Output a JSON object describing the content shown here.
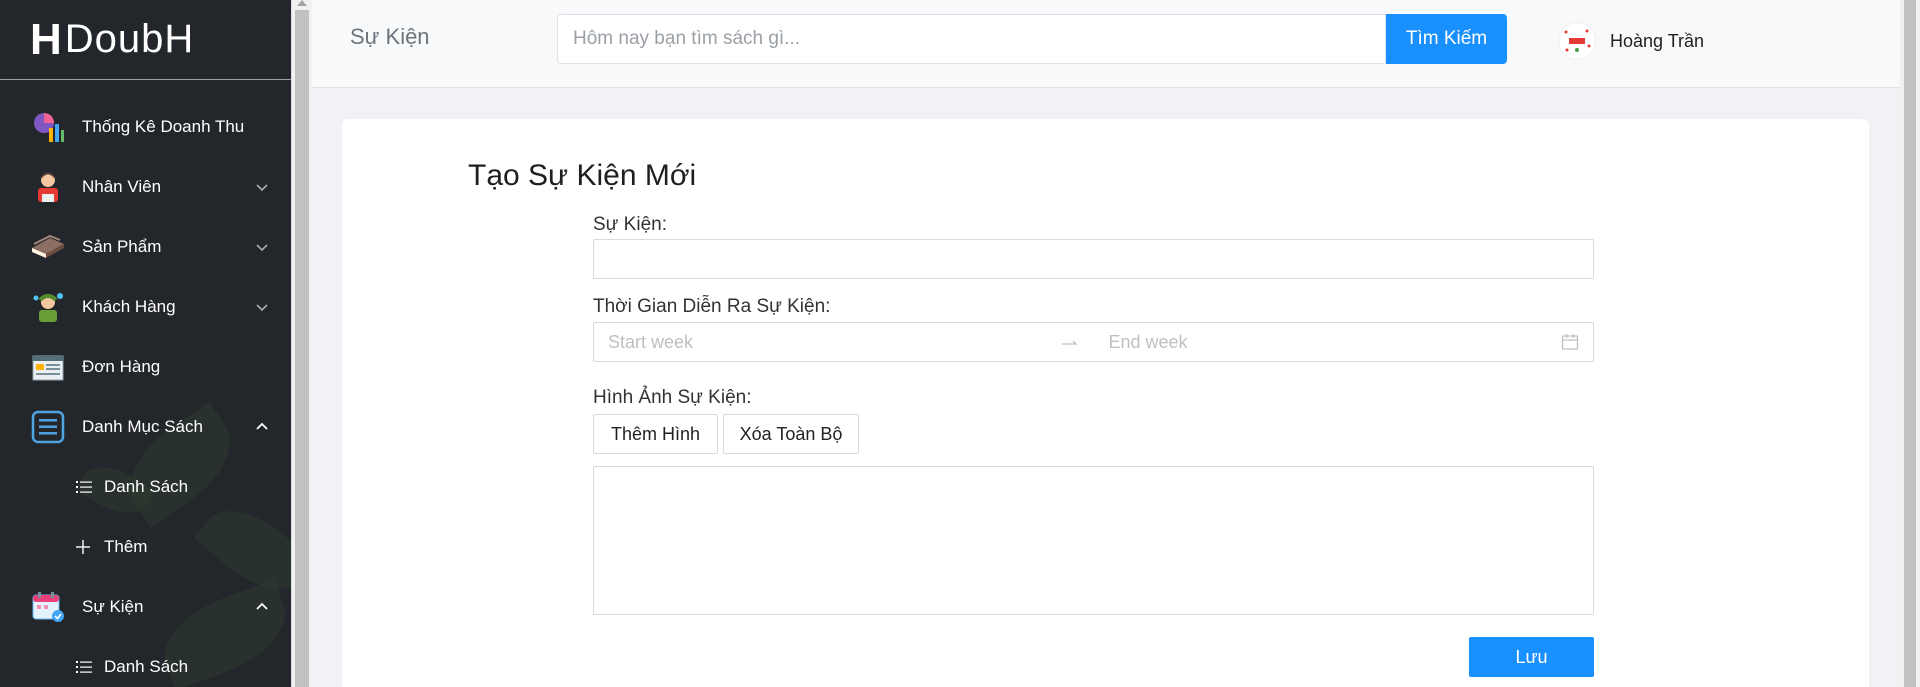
{
  "sidebar": {
    "logo": "DoubH",
    "items": [
      {
        "label": "Thống Kê Doanh Thu",
        "icon": "chart-icon"
      },
      {
        "label": "Nhân Viên",
        "icon": "employee-icon"
      },
      {
        "label": "Sản Phẩm",
        "icon": "books-icon"
      },
      {
        "label": "Khách Hàng",
        "icon": "customer-icon"
      },
      {
        "label": "Đơn Hàng",
        "icon": "order-icon"
      },
      {
        "label": "Danh Mục Sách",
        "icon": "list-icon"
      },
      {
        "label": "Sự Kiện",
        "icon": "calendar-icon"
      }
    ],
    "sub_categories": [
      {
        "label": "Danh Sách"
      },
      {
        "label": "Thêm"
      }
    ],
    "sub_events": [
      {
        "label": "Danh Sách"
      }
    ]
  },
  "header": {
    "title": "Sự Kiện",
    "search_placeholder": "Hôm nay bạn tìm sách gì...",
    "search_button": "Tìm Kiếm",
    "user_name": "Hoàng Trần"
  },
  "form": {
    "heading": "Tạo Sự Kiện Mới",
    "event_label": "Sự Kiện:",
    "event_value": "",
    "time_label": "Thời Gian Diễn Ra Sự Kiện:",
    "start_placeholder": "Start week",
    "end_placeholder": "End week",
    "image_label": "Hình Ảnh Sự Kiện:",
    "add_image_button": "Thêm Hình",
    "clear_all_button": "Xóa Toàn Bộ",
    "save_button": "Lưu"
  },
  "colors": {
    "sidebar_bg": "#23272b",
    "accent": "#1890ff"
  }
}
